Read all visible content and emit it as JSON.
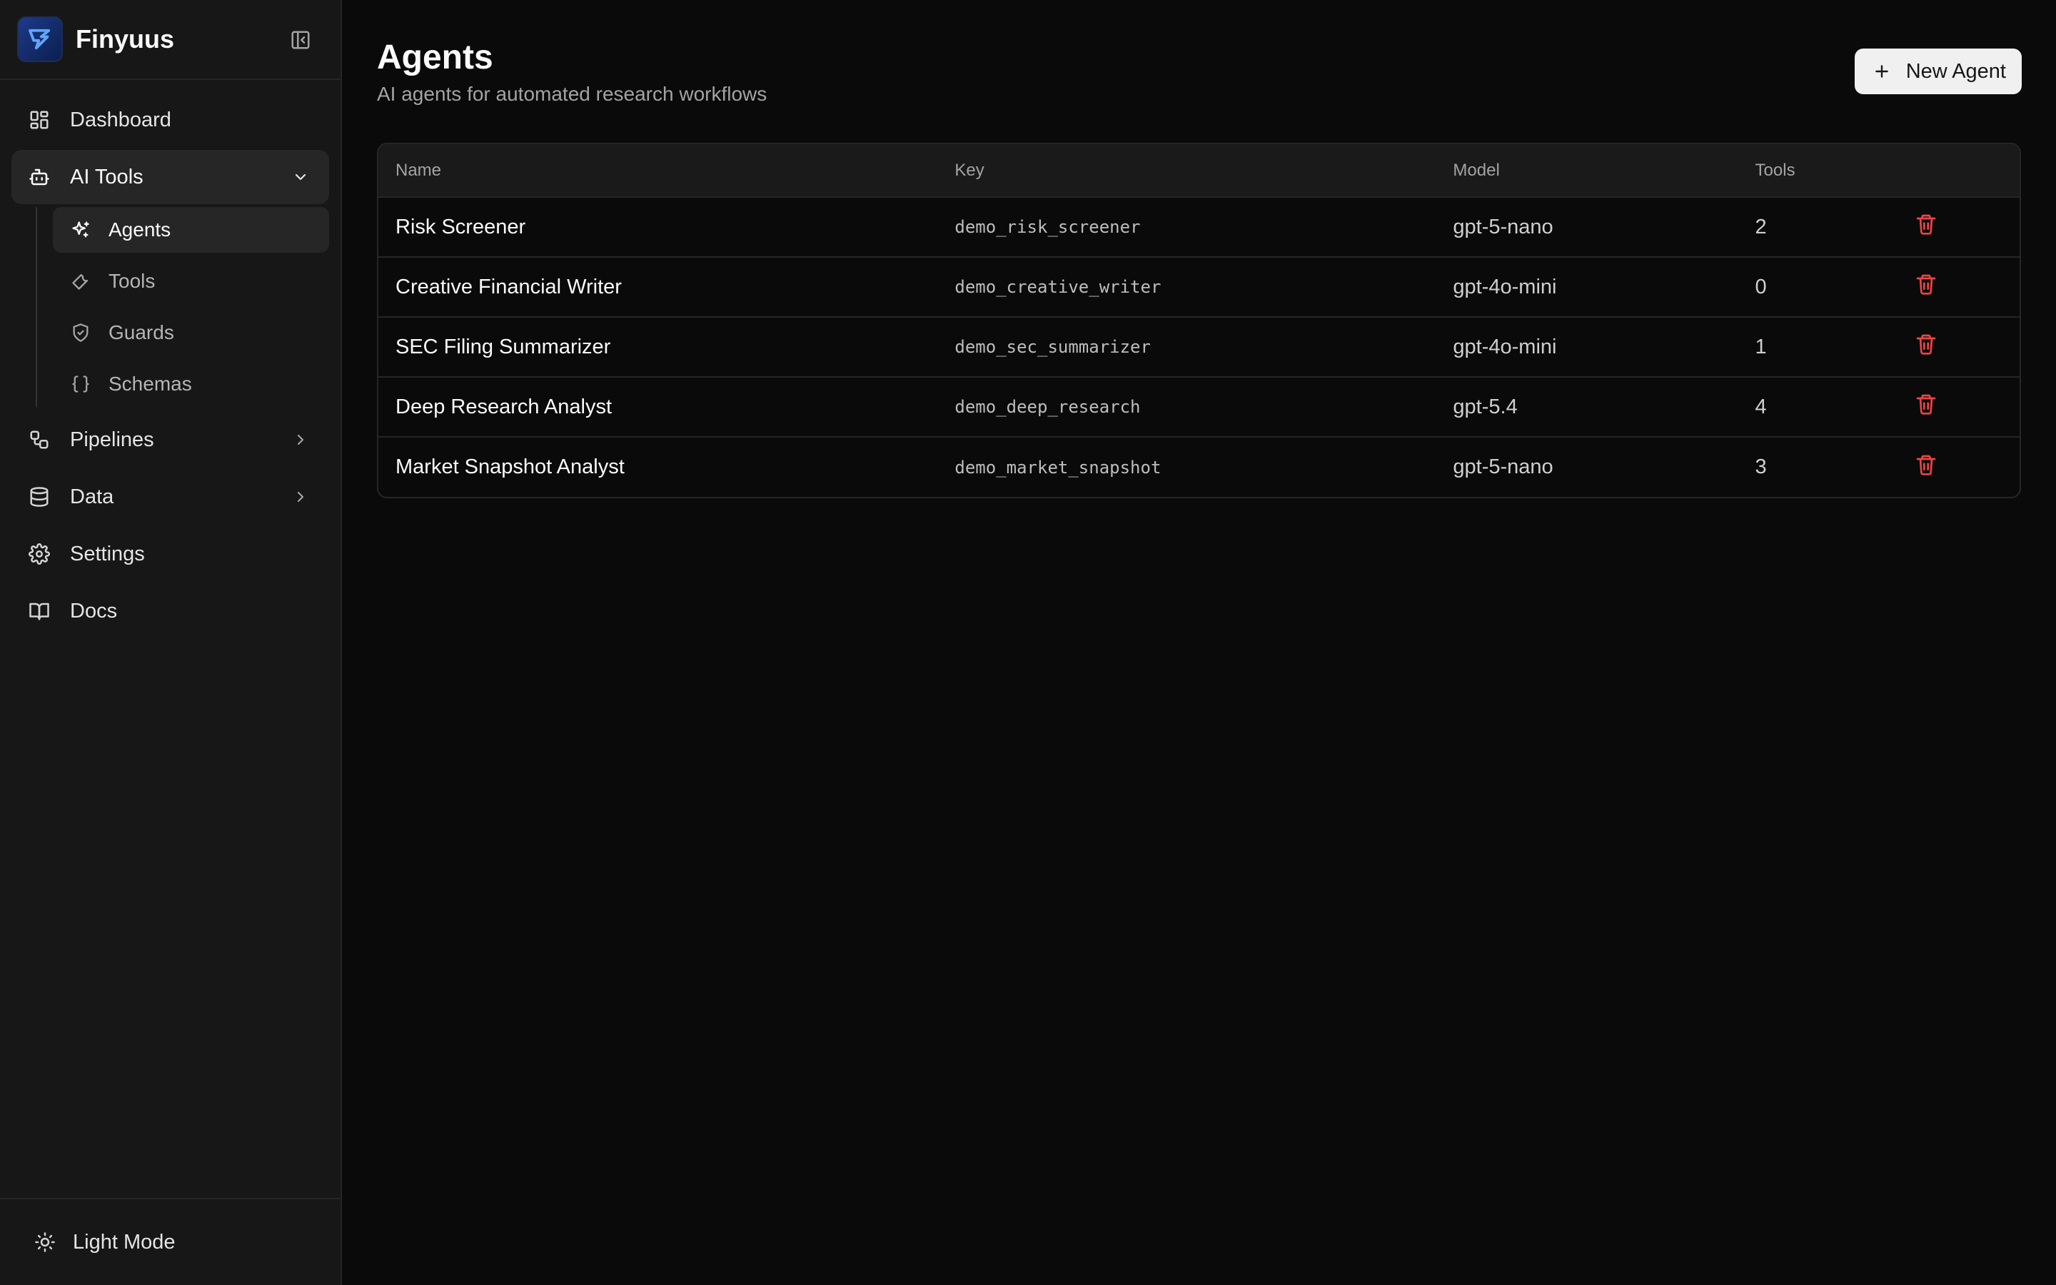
{
  "brand": {
    "name": "Finyuus"
  },
  "sidebar": {
    "items": [
      {
        "label": "Dashboard"
      },
      {
        "label": "AI Tools"
      },
      {
        "label": "Pipelines"
      },
      {
        "label": "Data"
      },
      {
        "label": "Settings"
      },
      {
        "label": "Docs"
      }
    ],
    "ai_tools_children": [
      {
        "label": "Agents"
      },
      {
        "label": "Tools"
      },
      {
        "label": "Guards"
      },
      {
        "label": "Schemas"
      }
    ],
    "footer": {
      "label": "Light Mode"
    }
  },
  "page": {
    "title": "Agents",
    "subtitle": "AI agents for automated research workflows",
    "new_button": "New Agent"
  },
  "table": {
    "columns": [
      "Name",
      "Key",
      "Model",
      "Tools"
    ],
    "rows": [
      {
        "name": "Risk Screener",
        "key": "demo_risk_screener",
        "model": "gpt-5-nano",
        "tools": "2"
      },
      {
        "name": "Creative Financial Writer",
        "key": "demo_creative_writer",
        "model": "gpt-4o-mini",
        "tools": "0"
      },
      {
        "name": "SEC Filing Summarizer",
        "key": "demo_sec_summarizer",
        "model": "gpt-4o-mini",
        "tools": "1"
      },
      {
        "name": "Deep Research Analyst",
        "key": "demo_deep_research",
        "model": "gpt-5.4",
        "tools": "4"
      },
      {
        "name": "Market Snapshot Analyst",
        "key": "demo_market_snapshot",
        "model": "gpt-5-nano",
        "tools": "3"
      }
    ]
  },
  "colors": {
    "background": "#0a0a0a",
    "sidebar": "#171717",
    "accent_delete": "#ef4444",
    "button_bg": "#f0f0f0"
  },
  "icons": {
    "dashboard": "layout-grid-icon",
    "ai_tools": "bot-icon",
    "agents": "sparkles-icon",
    "tools": "wrench-icon",
    "guards": "shield-check-icon",
    "schemas": "braces-icon",
    "pipelines": "workflow-icon",
    "data": "database-icon",
    "settings": "gear-icon",
    "docs": "book-icon",
    "footer": "sun-icon",
    "delete": "trash-icon"
  }
}
